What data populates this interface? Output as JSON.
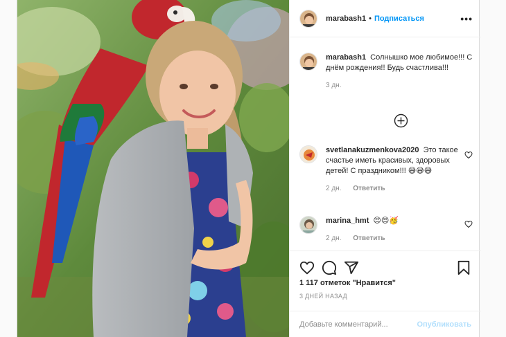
{
  "post": {
    "author": "marabash1",
    "header_separator": "•",
    "follow_label": "Подписаться",
    "more_label": "•••",
    "caption": {
      "username": "marabash1",
      "text": "Солнышко мое любимое!!! С днём рождения!! Будь счастлива!!!",
      "time": "3 дн."
    },
    "comments": [
      {
        "username": "svetlanakuzmenkova2020",
        "text": "Это такое счастье иметь красивых, здоровых детей! С праздником!!! 😅😅😅",
        "time": "2 дн.",
        "reply_label": "Ответить"
      },
      {
        "username": "marina_hmt",
        "text": "😍😍🥳",
        "time": "2 дн.",
        "reply_label": "Ответить"
      }
    ],
    "likes": "1 117 отметок \"Нравится\"",
    "date": "3 ДНЕЙ НАЗАД",
    "add_comment_placeholder": "Добавьте комментарий...",
    "publish_label": "Опубликовать"
  },
  "icons": {
    "more": "more-options-icon",
    "load_more": "plus-circle-icon",
    "like": "heart-icon",
    "comment": "comment-icon",
    "share": "share-icon",
    "save": "bookmark-icon",
    "comment_like": "heart-icon"
  },
  "colors": {
    "accent": "#0095f6",
    "publish_disabled": "#b2dffc",
    "muted": "#8e8e8e"
  }
}
